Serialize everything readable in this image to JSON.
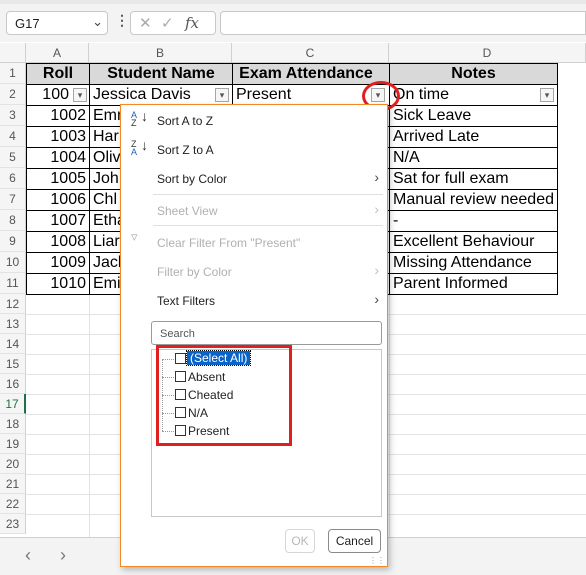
{
  "formula_bar": {
    "name_box": "G17",
    "fx_label": "fx",
    "formula": ""
  },
  "columns": [
    "A",
    "B",
    "C",
    "D"
  ],
  "rows": [
    "1",
    "2",
    "3",
    "4",
    "5",
    "6",
    "7",
    "8",
    "9",
    "10",
    "11",
    "12",
    "13",
    "14",
    "15",
    "16",
    "17",
    "18",
    "19",
    "20",
    "21",
    "22",
    "23"
  ],
  "selected_row": "17",
  "table": {
    "headers": [
      "Roll",
      "Student Name",
      "Exam Attendance",
      "Notes"
    ],
    "data": [
      [
        "100",
        "Jessica Davis",
        "Present",
        "On time"
      ],
      [
        "1002",
        "Emr",
        "",
        "Sick Leave"
      ],
      [
        "1003",
        "Har",
        "",
        "Arrived Late"
      ],
      [
        "1004",
        "Oliv",
        "",
        "N/A"
      ],
      [
        "1005",
        "Joh",
        "",
        "Sat for full exam"
      ],
      [
        "1006",
        "Chl",
        "",
        "Manual review needed"
      ],
      [
        "1007",
        "Etha",
        "",
        "-"
      ],
      [
        "1008",
        "Liar",
        "",
        "Excellent Behaviour"
      ],
      [
        "1009",
        "Jacl",
        "",
        "Missing Attendance"
      ],
      [
        "1010",
        "Emi",
        "",
        "Parent Informed"
      ]
    ]
  },
  "filter_menu": {
    "sort_az": "Sort A to Z",
    "sort_za": "Sort Z to A",
    "sort_by_color": "Sort by Color",
    "sheet_view": "Sheet View",
    "clear_filter": "Clear Filter From \"Present\"",
    "filter_by_color": "Filter by Color",
    "text_filters": "Text Filters",
    "search_placeholder": "Search",
    "values": [
      "(Select All)",
      "Absent",
      "Cheated",
      "N/A",
      "Present"
    ],
    "ok": "OK",
    "cancel": "Cancel"
  },
  "colors": {
    "highlight_red": "#e02020",
    "menu_border": "#f08a24",
    "selection_blue": "#0a64c8",
    "header_gray": "#d9d9d9"
  }
}
